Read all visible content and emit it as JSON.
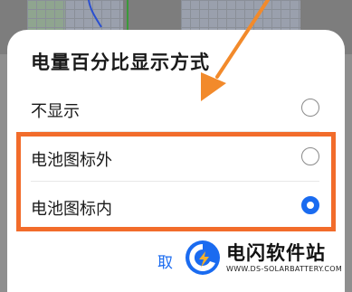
{
  "dialog": {
    "title": "电量百分比显示方式",
    "options": [
      {
        "label": "不显示",
        "selected": false
      },
      {
        "label": "电池图标外",
        "selected": false
      },
      {
        "label": "电池图标内",
        "selected": true
      }
    ],
    "cancel_label": "取"
  },
  "annotation": {
    "highlight_color": "#f26c2b",
    "arrow_color": "#f28a2b"
  },
  "watermark": {
    "title": "电闪软件站",
    "url": "WWW.DS-SOLARBATTERY.COM"
  },
  "colors": {
    "accent": "#1a6bf0",
    "dialog_bg": "#ffffff",
    "scrim": "#8f8f8f"
  }
}
